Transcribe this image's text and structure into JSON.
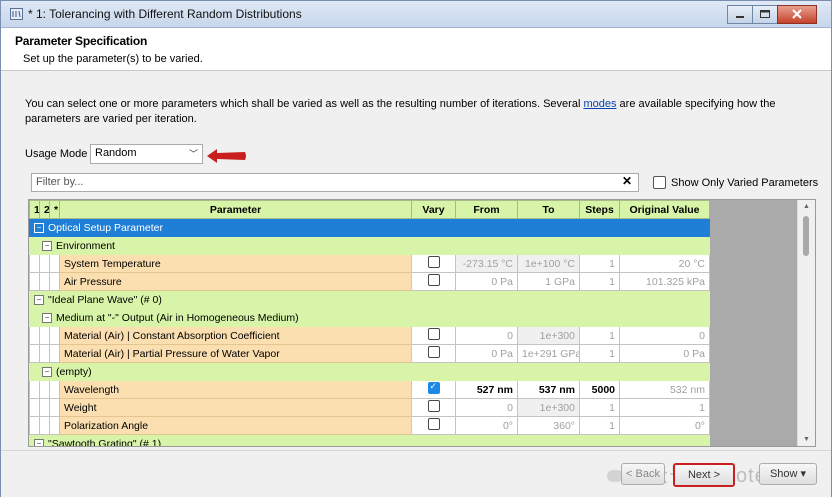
{
  "window": {
    "title": "* 1: Tolerancing with Different Random Distributions"
  },
  "header": {
    "title": "Parameter Specification",
    "subtitle": "Set up the parameter(s) to be varied."
  },
  "description": {
    "before": "You can select one or more parameters which shall be varied as well as the resulting number of iterations. Several ",
    "link": "modes",
    "after": " are available specifying how the parameters are varied per iteration."
  },
  "usage": {
    "label": "Usage Mode",
    "value": "Random"
  },
  "filter": {
    "placeholder": "Filter by...",
    "clear": "✕",
    "show_only_label": "Show Only Varied Parameters"
  },
  "grid": {
    "levels": [
      "1",
      "2",
      "*"
    ],
    "columns": {
      "parameter": "Parameter",
      "vary": "Vary",
      "from": "From",
      "to": "To",
      "steps": "Steps",
      "original": "Original Value"
    },
    "groups": {
      "optical_setup": "Optical Setup Parameter",
      "environment": "Environment",
      "ideal_plane_wave": "\"Ideal Plane Wave\" (# 0)",
      "medium": "Medium at \"-\" Output (Air in Homogeneous Medium)",
      "empty": "(empty)",
      "sawtooth": "\"Sawtooth Grating\" (# 1)"
    },
    "rows": {
      "system_temperature": {
        "name": "System Temperature",
        "vary": false,
        "from": "-273.15 °C",
        "to": "1e+100 °C",
        "steps": "1",
        "original": "20 °C"
      },
      "air_pressure": {
        "name": "Air Pressure",
        "vary": false,
        "from": "0 Pa",
        "to": "1 GPa",
        "steps": "1",
        "original": "101.325 kPa"
      },
      "absorption": {
        "name": "Material (Air) | Constant Absorption Coefficient",
        "vary": false,
        "from": "0",
        "to": "1e+300",
        "steps": "1",
        "original": "0"
      },
      "partial_pressure": {
        "name": "Material (Air) | Partial Pressure of Water Vapor",
        "vary": false,
        "from": "0 Pa",
        "to": "1e+291 GPa",
        "steps": "1",
        "original": "0 Pa"
      },
      "wavelength": {
        "name": "Wavelength",
        "vary": true,
        "from": "527 nm",
        "to": "537 nm",
        "steps": "5000",
        "original": "532 nm"
      },
      "weight": {
        "name": "Weight",
        "vary": false,
        "from": "0",
        "to": "1e+300",
        "steps": "1",
        "original": "1"
      },
      "polarization": {
        "name": "Polarization Angle",
        "vary": false,
        "from": "0°",
        "to": "360°",
        "steps": "1",
        "original": "0°"
      }
    }
  },
  "footer": {
    "back": "< Back",
    "next": "Next >",
    "show": "Show ▾",
    "watermark": "公众号 · Infotek"
  },
  "colors": {
    "accent_blue": "#1f7fd6",
    "group_green": "#d8f4a8",
    "param_orange": "#fbdfb0",
    "highlight_red": "#c82020"
  }
}
